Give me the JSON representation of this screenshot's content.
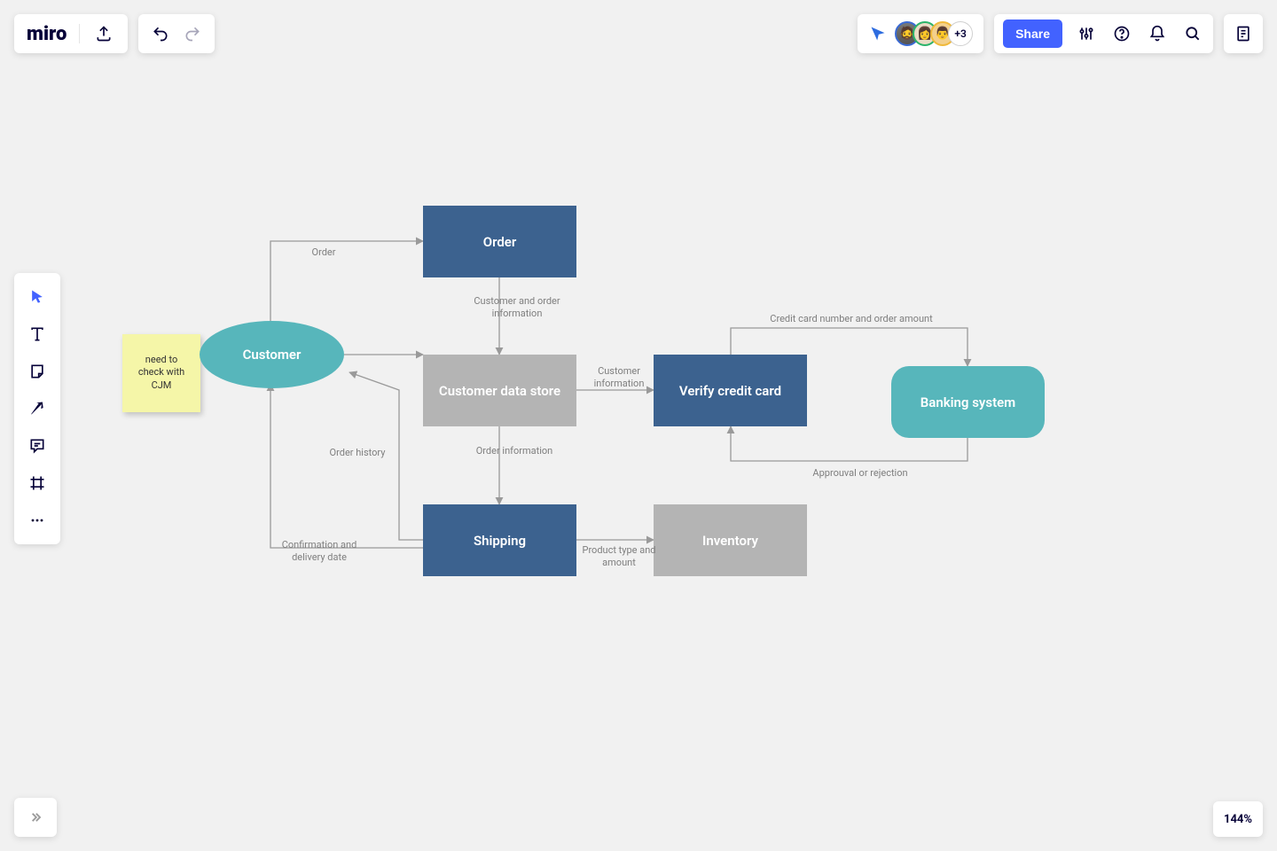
{
  "app": {
    "logo": "miro"
  },
  "presence": {
    "additional": "+3"
  },
  "toolbar_right": {
    "share": "Share"
  },
  "zoom": {
    "level": "144%"
  },
  "sticky": {
    "text": "need to check with CJM"
  },
  "nodes": {
    "customer": "Customer",
    "order": "Order",
    "cds": "Customer data store",
    "shipping": "Shipping",
    "verify": "Verify credit card",
    "inventory": "Inventory",
    "banking": "Banking system"
  },
  "edges": {
    "order": "Order",
    "cust_order_info": "Customer and order information",
    "cust_info": "Customer information",
    "order_info": "Order information",
    "order_history": "Order history",
    "confirmation": "Confirmation and delivery date",
    "product_type": "Product type and amount",
    "cc_number": "Credit card number and order amount",
    "approval": "Approuval or rejection"
  }
}
